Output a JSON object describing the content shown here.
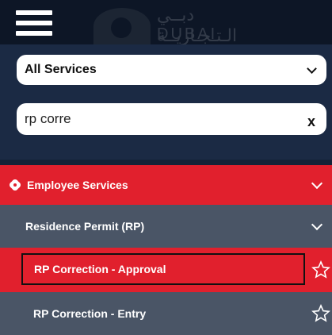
{
  "header": {
    "logo_arabic": "دبــي الـتـجـاريــة",
    "logo_latin": "DUBAI TRADE"
  },
  "filters": {
    "service_select_value": "All Services",
    "search_value": "rp corre",
    "clear_label": "x"
  },
  "menu": {
    "section_label": "Employee Services",
    "subsection_label": "Residence Permit (RP)",
    "items": [
      {
        "label": "RP Correction - Approval",
        "highlighted": true
      },
      {
        "label": "RP Correction - Entry",
        "highlighted": false
      }
    ]
  },
  "colors": {
    "accent_red": "#e1202d",
    "panel_navy": "#1b2a44",
    "row_gray": "#4a5566"
  }
}
